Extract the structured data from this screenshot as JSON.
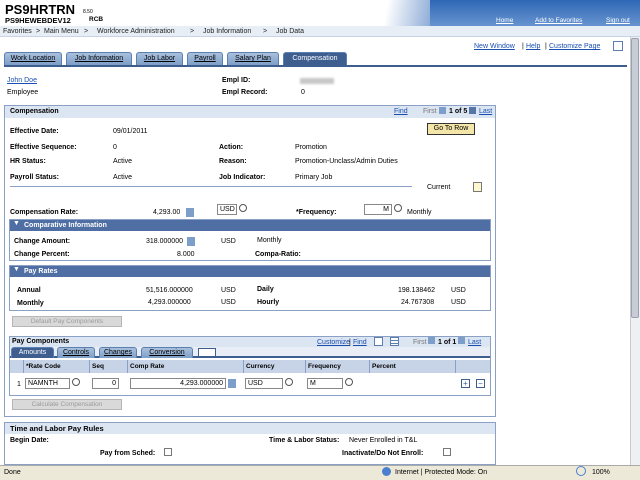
{
  "header": {
    "title": "PS9HRTRN",
    "version": "8.50",
    "db": "PS9HEWEBDEV12",
    "db2": "RCB",
    "links": [
      "Home",
      "Add to Favorites",
      "Sign out"
    ]
  },
  "breadcrumb": {
    "items": [
      "Favorites",
      "Main Menu",
      "Workforce Administration",
      "Job Information",
      "Job Data"
    ],
    "separator": ">"
  },
  "tabs": [
    "Work Location",
    "Job Information",
    "Job Labor",
    "Payroll",
    "Salary Plan",
    "Compensation"
  ],
  "toplinks": {
    "new_window": "New Window",
    "help": "Help",
    "customize": "Customize Page"
  },
  "employee": {
    "name": "John Doe",
    "type": "Employee",
    "empl_id_label": "Empl ID:",
    "empl_rcd_label": "Empl Record:",
    "empl_rcd": "0"
  },
  "compensation": {
    "title": "Compensation",
    "find": "Find",
    "first": "First",
    "of": "1 of 5",
    "last": "Last",
    "goto_row": "Go To Row",
    "eff_date_label": "Effective Date:",
    "eff_date": "09/01/2011",
    "eff_seq_label": "Effective Sequence:",
    "eff_seq": "0",
    "hr_status_label": "HR Status:",
    "hr_status": "Active",
    "payroll_status_label": "Payroll Status:",
    "payroll_status": "Active",
    "action_label": "Action:",
    "action": "Promotion",
    "reason_label": "Reason:",
    "reason": "Promotion-Unclass/Admin Duties",
    "job_ind_label": "Job Indicator:",
    "job_ind": "Primary Job",
    "current": "Current",
    "comp_rate_label": "Compensation Rate:",
    "comp_rate": "4,293.00",
    "currency": "USD",
    "frequency_label": "*Frequency:",
    "frequency": "M",
    "frequency_text": "Monthly"
  },
  "comparative": {
    "title": "Comparative Information",
    "change_amount_label": "Change Amount:",
    "change_amount": "318.000000",
    "change_amount_cur": "USD",
    "change_amount_freq": "Monthly",
    "change_percent_label": "Change Percent:",
    "change_percent": "8.000",
    "compa_ratio_label": "Compa-Ratio:"
  },
  "pay_rates": {
    "title": "Pay Rates",
    "annual_label": "Annual",
    "annual": "51,516.000000",
    "annual_cur": "USD",
    "monthly_label": "Monthly",
    "monthly": "4,293.000000",
    "monthly_cur": "USD",
    "daily_label": "Daily",
    "daily": "198.138462",
    "daily_cur": "USD",
    "hourly_label": "Hourly",
    "hourly": "24.767308",
    "hourly_cur": "USD",
    "detail_button": "Default Pay Components"
  },
  "pay_components": {
    "title": "Pay Components",
    "customize": "Customize",
    "find": "Find",
    "first": "First",
    "of": "1 of 1",
    "last": "Last",
    "subtabs": [
      "Amounts",
      "Controls",
      "Changes",
      "Conversion"
    ],
    "cols": [
      "*Rate Code",
      "Seq",
      "Comp Rate",
      "Currency",
      "Frequency",
      "Percent"
    ],
    "row": {
      "num": "1",
      "rate_code": "NAMNTH",
      "seq": "0",
      "comp_rate": "4,293.000000",
      "currency": "USD",
      "frequency": "M"
    },
    "calc_button": "Calculate Compensation"
  },
  "tl": {
    "title": "Time and Labor Pay Rules",
    "begin_date_label": "Begin Date:",
    "tl_status_label": "Time & Labor Status:",
    "tl_status": "Never Enrolled in T&L",
    "pay_from_sched_label": "Pay from Sched:",
    "inactivate_label": "Inactivate/Do Not Enroll:"
  },
  "status": {
    "done": "Done",
    "zone": "Internet | Protected Mode: On",
    "zoom": "100%"
  }
}
